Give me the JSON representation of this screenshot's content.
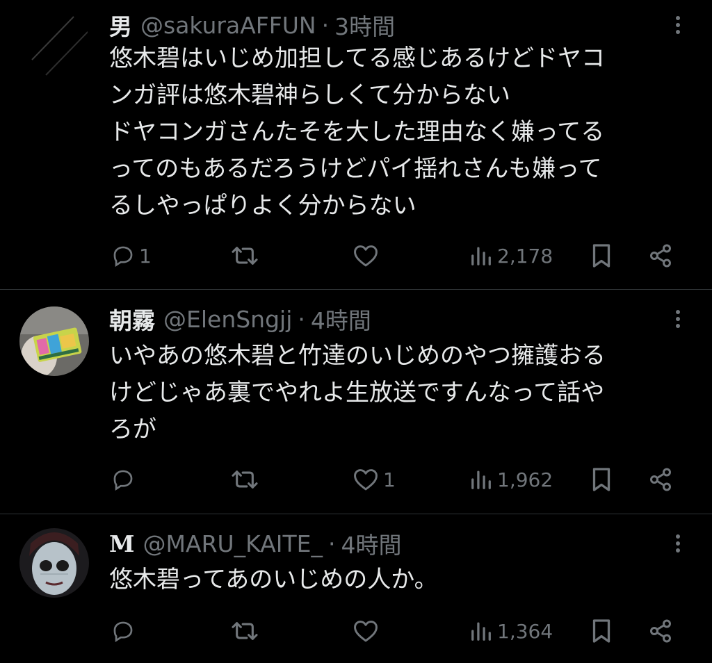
{
  "tweets": [
    {
      "name": "男",
      "handle": "@sakuraAFFUN",
      "separator": "·",
      "time": "3時間",
      "text": "悠木碧はいじめ加担してる感じあるけどドヤコ\nンガ評は悠木碧神らしくて分からない\nドヤコンガさんたそを大した理由なく嫌ってる\nってのもあるだろうけどパイ揺れさんも嫌って\nるしやっぱりよく分からない",
      "replies": "1",
      "retweets": "",
      "likes": "",
      "views": "2,178"
    },
    {
      "name": "朝霧",
      "handle": "@ElenSngjj",
      "separator": "·",
      "time": "4時間",
      "text": "いやあの悠木碧と竹達のいじめのやつ擁護おる\nけどじゃあ裏でやれよ生放送ですんなって話や\nろが",
      "replies": "",
      "retweets": "",
      "likes": "1",
      "views": "1,962"
    },
    {
      "name": "M",
      "handle": "@MARU_KAITE_",
      "separator": "·",
      "time": "4時間",
      "text": "悠木碧ってあのいじめの人か。",
      "replies": "",
      "retweets": "",
      "likes": "",
      "views": "1,364"
    }
  ],
  "icons": {
    "reply": "reply-icon",
    "retweet": "retweet-icon",
    "like": "heart-icon",
    "views": "views-icon",
    "bookmark": "bookmark-icon",
    "share": "share-icon",
    "more": "more-icon"
  },
  "colors": {
    "background": "#000000",
    "text": "#e7e9ea",
    "muted": "#71767b",
    "divider": "#2f3336"
  }
}
